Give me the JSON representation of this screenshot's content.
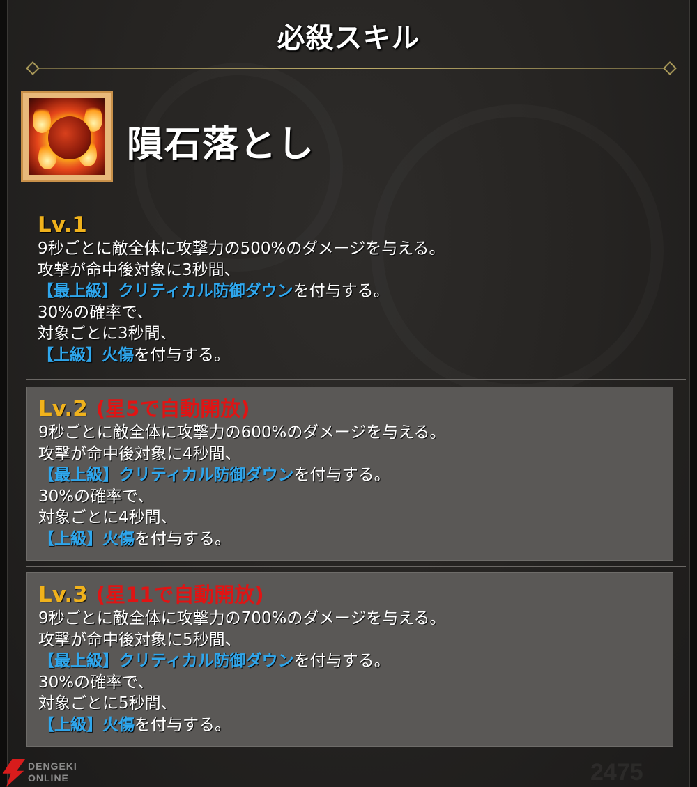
{
  "header": {
    "title": "必殺スキル"
  },
  "skill": {
    "name": "隕石落とし",
    "icon": "meteor-fire-icon"
  },
  "levels": [
    {
      "level": "Lv.1",
      "unlock": "",
      "lines": [
        "9秒ごとに敵全体に攻撃力の500%のダメージを与える。",
        "攻撃が命中後対象に3秒間、"
      ],
      "debuff1": {
        "name": "【最上級】クリティカル防御ダウン",
        "suffix": "を付与する。"
      },
      "lines2": [
        "30%の確率で、",
        "対象ごとに3秒間、"
      ],
      "debuff2": {
        "name": "【上級】火傷",
        "suffix": "を付与する。"
      }
    },
    {
      "level": "Lv.2",
      "unlock": "(星5で自動開放)",
      "lines": [
        "9秒ごとに敵全体に攻撃力の600%のダメージを与える。",
        "攻撃が命中後対象に4秒間、"
      ],
      "debuff1": {
        "name": "【最上級】クリティカル防御ダウン",
        "suffix": "を付与する。"
      },
      "lines2": [
        "30%の確率で、",
        "対象ごとに4秒間、"
      ],
      "debuff2": {
        "name": "【上級】火傷",
        "suffix": "を付与する。"
      }
    },
    {
      "level": "Lv.3",
      "unlock": "(星11で自動開放)",
      "lines": [
        "9秒ごとに敵全体に攻撃力の700%のダメージを与える。",
        "攻撃が命中後対象に5秒間、"
      ],
      "debuff1": {
        "name": "【最上級】クリティカル防御ダウン",
        "suffix": "を付与する。"
      },
      "lines2": [
        "30%の確率で、",
        "対象ごとに5秒間、"
      ],
      "debuff2": {
        "name": "【上級】火傷",
        "suffix": "を付与する。"
      }
    }
  ],
  "watermark": {
    "line1": "DENGEKI",
    "line2": "ONLINE"
  },
  "background_number": "2475",
  "colors": {
    "level_label": "#f0b21c",
    "unlock_text": "#e01414",
    "debuff_text": "#2fa6ec",
    "boxed_bg": "#5a5856"
  }
}
